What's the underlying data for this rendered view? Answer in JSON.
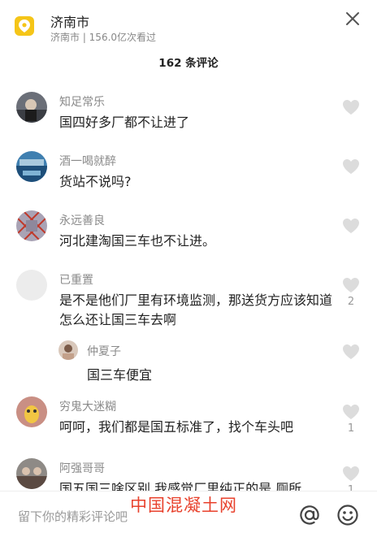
{
  "header": {
    "title": "济南市",
    "subtitle": "济南市 | 156.0亿次看过"
  },
  "comment_count": "162 条评论",
  "comments": [
    {
      "user": "知足常乐",
      "text": "国四好多厂都不让进了",
      "likes": ""
    },
    {
      "user": "酒一喝就醉",
      "text": "货站不说吗?",
      "likes": ""
    },
    {
      "user": "永远善良",
      "text": "河北建淘国三车也不让进。",
      "likes": ""
    },
    {
      "user": "已重置",
      "text": "是不是他们厂里有环境监测，那送货方应该知道怎么还让国三车去啊",
      "likes": "2",
      "reply": {
        "user": "仲夏子",
        "text": "国三车便宜"
      }
    },
    {
      "user": "穷鬼大迷糊",
      "text": "呵呵，我们都是国五标准了，找个车头吧",
      "likes": "1"
    },
    {
      "user": "阿强哥哥",
      "text": "国五国三啥区别 我感觉厂里纯正的是 厕所",
      "likes": "1"
    }
  ],
  "bottom_bar": {
    "input_placeholder": "留下你的精彩评论吧"
  },
  "watermark": "中国混凝土网",
  "colors": {
    "accent": "#f5c518",
    "watermark": "#e8412c"
  }
}
